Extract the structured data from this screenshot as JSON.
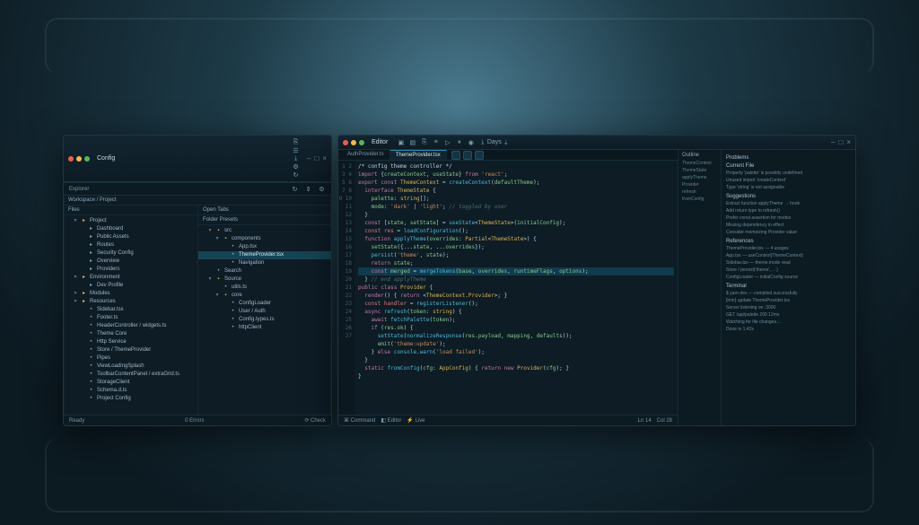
{
  "leftWindow": {
    "title": "Config",
    "toolbar": {
      "label": "Explorer",
      "icons": [
        "⎘",
        "☰",
        "⤓",
        "⚙",
        "↻"
      ]
    },
    "subheader": "Workspace / Project",
    "paneA": {
      "header": "Files",
      "sections": [
        {
          "label": "Project",
          "items": [
            {
              "label": "Dashboard",
              "icon": "▸",
              "cls": "file"
            },
            {
              "label": "Public Assets",
              "icon": "▸",
              "cls": "file"
            },
            {
              "label": "Routes",
              "icon": "▸",
              "cls": "file"
            },
            {
              "label": "Security Config",
              "icon": "▸",
              "cls": "file"
            },
            {
              "label": "Overview",
              "icon": "▸",
              "cls": "file"
            },
            {
              "label": "Providers",
              "icon": "▸",
              "cls": "file"
            }
          ]
        },
        {
          "label": "Environment",
          "items": [
            {
              "label": "Dev Profile",
              "icon": "▸",
              "cls": "file"
            }
          ]
        },
        {
          "label": "Modules",
          "items": []
        },
        {
          "label": "Resources",
          "items": [
            {
              "label": "Sidebar.tsx",
              "icon": "•",
              "cls": "file"
            },
            {
              "label": "Footer.ts",
              "icon": "•",
              "cls": "file"
            },
            {
              "label": "HeaderController / widgets.ts",
              "icon": "•",
              "cls": "file"
            },
            {
              "label": "Theme Core",
              "icon": "•",
              "cls": "file"
            },
            {
              "label": "Http Service",
              "icon": "•",
              "cls": "file"
            },
            {
              "label": "Store / ThemeProvider",
              "icon": "•",
              "cls": "file"
            },
            {
              "label": "Pipes",
              "icon": "•",
              "cls": "file"
            },
            {
              "label": "ViewLoadingSplash",
              "icon": "•",
              "cls": "file"
            },
            {
              "label": "ToolbarContentPanel / extraGrid.ts",
              "icon": "•",
              "cls": "file"
            },
            {
              "label": "StorageClient",
              "icon": "•",
              "cls": "file"
            },
            {
              "label": "Schema.d.ts",
              "icon": "•",
              "cls": "file"
            },
            {
              "label": "Project Config",
              "icon": "•",
              "cls": "file"
            }
          ]
        }
      ]
    },
    "paneB": {
      "header1": "Open Tabs",
      "header2": "Folder Presets",
      "tree": [
        {
          "label": "src",
          "expanded": true,
          "children": [
            {
              "label": "components",
              "expanded": true,
              "children": [
                {
                  "label": "App.tsx"
                },
                {
                  "label": "ThemeProvider.tsx",
                  "selected": true
                },
                {
                  "label": "Navigation"
                }
              ]
            }
          ]
        },
        {
          "label": "Search",
          "expanded": false
        },
        {
          "label": "Source",
          "expanded": true,
          "children": [
            {
              "label": "utils.ts"
            },
            {
              "label": "core",
              "children": [
                {
                  "label": "ConfigLoader"
                },
                {
                  "label": "User / Auth"
                },
                {
                  "label": "Config.types.ts"
                },
                {
                  "label": "httpClient"
                }
              ]
            }
          ]
        }
      ]
    },
    "status": {
      "left": "Ready",
      "mid": "0 Errors",
      "right": "⟳ Check"
    }
  },
  "rightWindow": {
    "title": "Editor",
    "toolbarIcons": [
      "▣",
      "▤",
      "⎘",
      "≡",
      "▷",
      "⏸",
      "◉",
      "⤓",
      "Days",
      "⇣"
    ],
    "tabs": [
      {
        "label": "AuthProvider.ts"
      },
      {
        "label": "ThemeProvider.tsx",
        "active": true
      }
    ],
    "code": [
      {
        "t": "cm",
        "s": "/* config theme controller */"
      },
      {
        "t": "",
        "s": "<kw>import</kw> {<id>createContext</id>, <id>useState</id>} <kw>from</kw> <st>'react'</st>;"
      },
      {
        "t": "",
        "s": "<kw>export const</kw> <ty>ThemeContext</ty> = <fn>createContext</fn>(<id>defaultTheme</id>);"
      },
      {
        "t": "",
        "s": "  <kw>interface</kw> <ty>ThemeState</ty> {"
      },
      {
        "t": "",
        "s": "    <id>palette</id>: <ty>string</ty>[];"
      },
      {
        "t": "",
        "s": "    <id>mode</id>: <st>'dark'</st> | <st>'light'</st>; <cm>// toggled by user</cm>"
      },
      {
        "t": "",
        "s": "  }"
      },
      {
        "t": "",
        "s": "  <kw>const</kw> [<id>state</id>, <id>setState</id>] = <fn>useState</fn><<ty>ThemeState</ty>>(<id>initialConfig</id>);"
      },
      {
        "t": "",
        "s": "  <err>const res</err> = <fn>loadConfiguration</fn>();"
      },
      {
        "t": "",
        "s": "  <kw>function</kw> <fn>applyTheme</fn>(<id>overrides</id>: <ty>Partial</ty><<ty>ThemeState</ty>>) {"
      },
      {
        "t": "",
        "s": "    <id>setState</id>({...<id>state</id>, ...<id>overrides</id>});"
      },
      {
        "t": "",
        "s": "    <fn>persist</fn>(<st>'theme'</st>, <id>state</id>);"
      },
      {
        "t": "",
        "s": "    <kw>return</kw> <id>state</id>;"
      },
      {
        "t": "hl",
        "s": "    <kw>const</kw> <id>merged</id> = <fn>mergeTokens</fn>(<id>base</id>, <id>overrides</id>, <id>runtimeFlags</id>, <id>options</id>);"
      },
      {
        "t": "",
        "s": "  } <cm>// end applyTheme</cm>"
      },
      {
        "t": "",
        "s": "<kw>public</kw> <kw>class</kw> <ty>Provider</ty> {"
      },
      {
        "t": "",
        "s": "  <kw>render</kw>() { <kw>return</kw> <<ty>ThemeContext.Provider</ty>>; }"
      },
      {
        "t": "",
        "s": "  <err>const handler</err> = <fn>registerListener</fn>();"
      },
      {
        "t": "",
        "s": "  <kw>async</kw> <fn>refresh</fn>(<id>token</id>: <ty>string</ty>) {"
      },
      {
        "t": "",
        "s": "    <kw>await</kw> <fn>fetchPalette</fn>(<id>token</id>);"
      },
      {
        "t": "",
        "s": "    <kw>if</kw> (<id>res</id>.<id>ok</id>) {"
      },
      {
        "t": "",
        "s": "      <fn>setState</fn>(<fn>normalizeResponse</fn>(<id>res</id>.<id>payload</id>, <id>mapping</id>, <id>defaults</id>));"
      },
      {
        "t": "",
        "s": "      <id>emit</id>(<st>'theme:update'</st>);"
      },
      {
        "t": "",
        "s": "    } <kw>else</kw> <fn>console</fn>.<fn>warn</fn>(<st>'load failed'</st>);"
      },
      {
        "t": "",
        "s": "  }"
      },
      {
        "t": "",
        "s": "  <kw>static</kw> <fn>fromConfig</fn>(<id>cfg</id>: <ty>AppConfig</ty>) { <kw>return</kw> <kw>new</kw> <ty>Provider</ty>(<id>cfg</id>); }"
      },
      {
        "t": "",
        "s": "}"
      }
    ],
    "sideRail": {
      "header": "Outline",
      "items": [
        "ThemeContext",
        "ThemeState",
        "applyTheme",
        "Provider",
        "refresh",
        "fromConfig"
      ]
    },
    "rightPanel": {
      "header": "Problems",
      "groups": [
        {
          "title": "Current File",
          "rows": [
            "Property 'palette' is possibly undefined",
            "Unused import 'createContext'",
            "Type 'string' is not assignable"
          ]
        },
        {
          "title": "Suggestions",
          "rows": [
            "Extract function applyTheme → hook",
            "Add return type to refresh()",
            "Prefer const assertion for modes",
            "Missing dependency in effect",
            "Consider memoizing Provider value"
          ]
        },
        {
          "title": "References",
          "rows": [
            "ThemeProvider.tsx — 4 usages",
            "App.tsx — useContext(ThemeContext)",
            "Sidebar.tsx — theme.mode read",
            "Store / persist('theme', …)",
            "ConfigLoader — initialConfig source"
          ]
        },
        {
          "title": "Terminal",
          "rows": [
            "$ yarn dev — compiled successfully",
            "[hmr] update ThemeProvider.tsx",
            "Server listening on :3000",
            "GET /api/palette 200 12ms",
            "Watching for file changes…",
            "Done in 1.42s"
          ]
        }
      ]
    },
    "status": {
      "items": [
        "⌘ Command",
        "◧ Editor",
        "⚡ Live",
        "",
        "Ln 14",
        "Col 28"
      ]
    }
  }
}
